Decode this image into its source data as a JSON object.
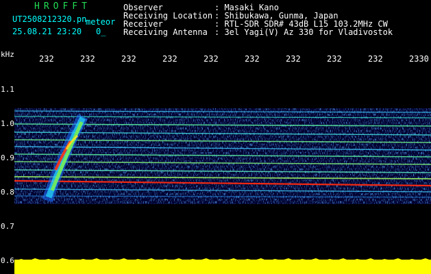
{
  "app": {
    "name": "HROFFT"
  },
  "file": {
    "name": "UT2508212320.pn",
    "mode": "meteor",
    "datetime": "25.08.21 23:20",
    "count": "0_"
  },
  "station": {
    "labels": [
      "Observer",
      "Receiving Location",
      "Receiver",
      "Receiving Antenna"
    ],
    "values": [
      ": Masaki Kano",
      ": Shibukawa, Gunma, Japan",
      ": RTL-SDR SDR# 43dB L15 103.2MHz CW",
      ": 3el Yagi(V) Az 330 for Vladivostok"
    ]
  },
  "axis": {
    "unit": "kHz",
    "time_ticks": [
      "232",
      "232",
      "232",
      "232",
      "232",
      "232",
      "232",
      "232",
      "232",
      "2330"
    ],
    "freq_ticks": [
      "1.1",
      "1.0",
      "0.9",
      "0.8",
      "0.7",
      "0.6"
    ]
  },
  "colors": {
    "background": "#000000",
    "label": "#00ffff",
    "value": "#ffffff",
    "title": "#22dd55",
    "noise_floor": "#ffff00"
  }
}
